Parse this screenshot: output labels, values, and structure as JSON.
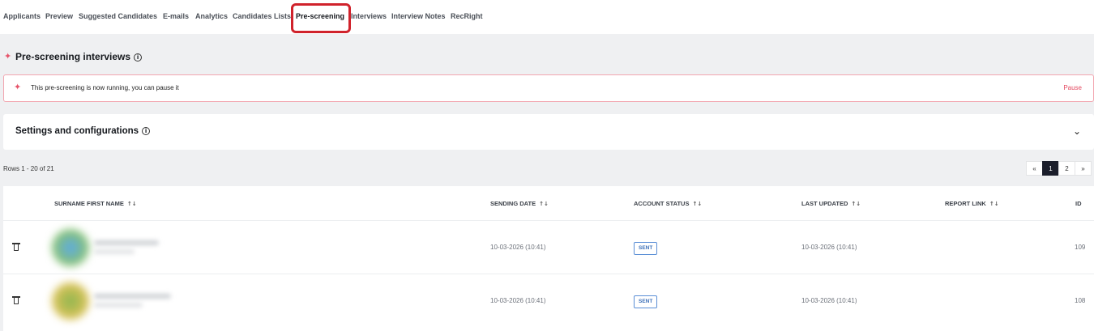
{
  "tabs": [
    {
      "label": "Applicants"
    },
    {
      "label": "Preview"
    },
    {
      "label": "Suggested Candidates"
    },
    {
      "label": "E-mails"
    },
    {
      "label": "Analytics"
    },
    {
      "label": "Candidates Lists"
    },
    {
      "label": "Pre-screening",
      "active": true
    },
    {
      "label": "Interviews"
    },
    {
      "label": "Interview Notes"
    },
    {
      "label": "RecRight"
    }
  ],
  "header": {
    "title": "Pre-screening interviews",
    "info": "i"
  },
  "alert": {
    "message": "This pre-screening is now running, you can pause it",
    "action": "Pause"
  },
  "settings": {
    "title": "Settings and configurations",
    "info": "i",
    "chevron": "⌄"
  },
  "pagination": {
    "rows_label": "Rows 1 - 20 of 21",
    "prev": "«",
    "pages": [
      "1",
      "2"
    ],
    "next": "»",
    "current": "1"
  },
  "table": {
    "columns": [
      "SURNAME FIRST NAME",
      "SENDING DATE",
      "ACCOUNT STATUS",
      "LAST UPDATED",
      "REPORT LINK",
      "ID"
    ],
    "sort_icon": "↑↓",
    "rows": [
      {
        "sending_date": "10-03-2026 (10:41)",
        "status": "SENT",
        "last_updated": "10-03-2026 (10:41)",
        "report_link": "",
        "id": "109"
      },
      {
        "sending_date": "10-03-2026 (10:41)",
        "status": "SENT",
        "last_updated": "10-03-2026 (10:41)",
        "report_link": "",
        "id": "108"
      }
    ]
  },
  "colors": {
    "accent": "#d0222b",
    "alert_text": "#e44a61",
    "badge": "#3b6fb8",
    "page_bg": "#eff0f2"
  },
  "icons": {
    "sparkle": "sparkle-icon",
    "info": "info-icon",
    "chevron": "chevron-down-icon",
    "sort": "sort-icon",
    "delete": "trash-icon"
  }
}
